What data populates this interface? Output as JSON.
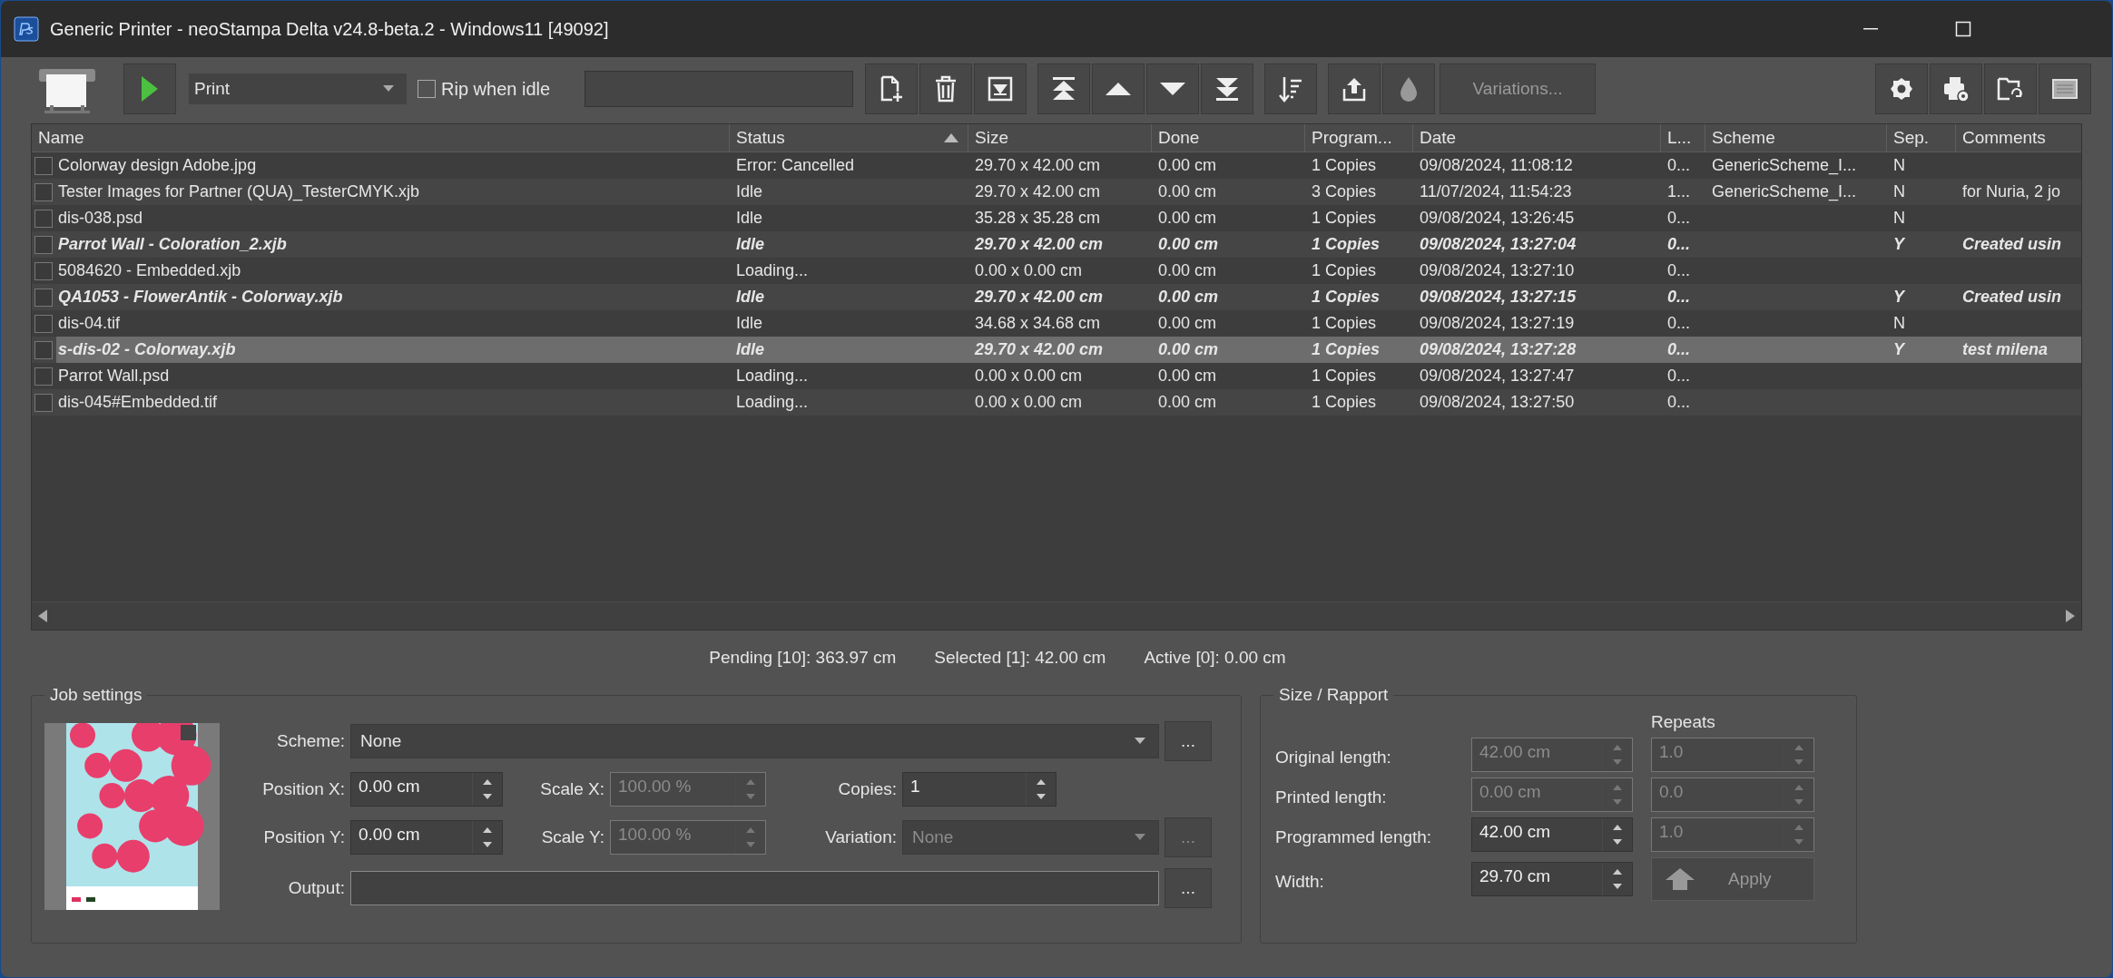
{
  "window": {
    "title": "Generic Printer - neoStampa Delta v24.8-beta.2 - Windows11 [49092]"
  },
  "toolbar": {
    "mode": "Print",
    "rip_when_idle": {
      "label": "Rip when idle",
      "checked": false
    },
    "variations_button": {
      "label": "Variations...",
      "disabled": true
    }
  },
  "table": {
    "columns": [
      {
        "label": "Name"
      },
      {
        "label": "Status",
        "sorted": true
      },
      {
        "label": "Size"
      },
      {
        "label": "Done"
      },
      {
        "label": "Program..."
      },
      {
        "label": "Date"
      },
      {
        "label": "L..."
      },
      {
        "label": "Scheme"
      },
      {
        "label": "Sep."
      },
      {
        "label": "Comments"
      }
    ],
    "rows": [
      {
        "checked": false,
        "bold": false,
        "selected": false,
        "cells": [
          "Colorway design Adobe.jpg",
          "Error: Cancelled",
          "29.70 x 42.00 cm",
          "0.00 cm",
          "1 Copies",
          "09/08/2024, 11:08:12",
          "0...",
          "GenericScheme_I...",
          "N",
          ""
        ]
      },
      {
        "checked": false,
        "bold": false,
        "selected": false,
        "cells": [
          "Tester Images for Partner (QUA)_TesterCMYK.xjb",
          "Idle",
          "29.70 x 42.00 cm",
          "0.00 cm",
          "3 Copies",
          "11/07/2024, 11:54:23",
          "1...",
          "GenericScheme_I...",
          "N",
          "for Nuria, 2 jo"
        ]
      },
      {
        "checked": false,
        "bold": false,
        "selected": false,
        "cells": [
          "dis-038.psd",
          "Idle",
          "35.28 x 35.28 cm",
          "0.00 cm",
          "1 Copies",
          "09/08/2024, 13:26:45",
          "0...",
          "",
          "N",
          ""
        ]
      },
      {
        "checked": false,
        "bold": true,
        "selected": false,
        "cells": [
          "Parrot Wall - Coloration_2.xjb",
          "Idle",
          "29.70 x 42.00 cm",
          "0.00 cm",
          "1 Copies",
          "09/08/2024, 13:27:04",
          "0...",
          "",
          "Y",
          "Created usin"
        ]
      },
      {
        "checked": false,
        "bold": false,
        "selected": false,
        "cells": [
          "5084620 - Embedded.xjb",
          "Loading...",
          "0.00 x 0.00 cm",
          "0.00 cm",
          "1 Copies",
          "09/08/2024, 13:27:10",
          "0...",
          "",
          "",
          ""
        ]
      },
      {
        "checked": false,
        "bold": true,
        "selected": false,
        "cells": [
          "QA1053 - FlowerAntik - Colorway.xjb",
          "Idle",
          "29.70 x 42.00 cm",
          "0.00 cm",
          "1 Copies",
          "09/08/2024, 13:27:15",
          "0...",
          "",
          "Y",
          "Created usin"
        ]
      },
      {
        "checked": false,
        "bold": false,
        "selected": false,
        "cells": [
          "dis-04.tif",
          "Idle",
          "34.68 x 34.68 cm",
          "0.00 cm",
          "1 Copies",
          "09/08/2024, 13:27:19",
          "0...",
          "",
          "N",
          ""
        ]
      },
      {
        "checked": false,
        "bold": true,
        "selected": true,
        "cells": [
          "s-dis-02 - Colorway.xjb",
          "Idle",
          "29.70 x 42.00 cm",
          "0.00 cm",
          "1 Copies",
          "09/08/2024, 13:27:28",
          "0...",
          "",
          "Y",
          "test milena"
        ]
      },
      {
        "checked": false,
        "bold": false,
        "selected": false,
        "cells": [
          "Parrot Wall.psd",
          "Loading...",
          "0.00 x 0.00 cm",
          "0.00 cm",
          "1 Copies",
          "09/08/2024, 13:27:47",
          "0...",
          "",
          "",
          ""
        ]
      },
      {
        "checked": false,
        "bold": false,
        "selected": false,
        "cells": [
          "dis-045#Embedded.tif",
          "Loading...",
          "0.00 x 0.00 cm",
          "0.00 cm",
          "1 Copies",
          "09/08/2024, 13:27:50",
          "0...",
          "",
          "",
          ""
        ]
      }
    ]
  },
  "summary": [
    "Pending [10]: 363.97 cm",
    "Selected [1]: 42.00 cm",
    "Active [0]: 0.00 cm"
  ],
  "job_settings": {
    "title": "Job settings",
    "scheme": {
      "label": "Scheme:",
      "value": "None",
      "disabled": false,
      "browse": "..."
    },
    "position_x": {
      "label": "Position X:",
      "value": "0.00 cm",
      "disabled": false
    },
    "scale_x": {
      "label": "Scale X:",
      "value": "100.00 %",
      "disabled": true
    },
    "copies": {
      "label": "Copies:",
      "value": "1",
      "disabled": false
    },
    "position_y": {
      "label": "Position Y:",
      "value": "0.00 cm",
      "disabled": false
    },
    "scale_y": {
      "label": "Scale Y:",
      "value": "100.00 %",
      "disabled": true
    },
    "variation": {
      "label": "Variation:",
      "value": "None",
      "disabled": true,
      "browse": "..."
    },
    "output": {
      "label": "Output:",
      "disabled": false,
      "browse": "..."
    }
  },
  "size_rapport": {
    "title": "Size / Rapport",
    "repeats_label": "Repeats",
    "rows": [
      {
        "label": "Original length:",
        "length": {
          "value": "42.00 cm",
          "disabled": true
        },
        "repeats": {
          "value": "1.0",
          "disabled": true
        }
      },
      {
        "label": "Printed length:",
        "length": {
          "value": "0.00 cm",
          "disabled": true
        },
        "repeats": {
          "value": "0.0",
          "disabled": true
        }
      },
      {
        "label": "Programmed length:",
        "length": {
          "value": "42.00 cm",
          "disabled": false
        },
        "repeats": {
          "value": "1.0",
          "disabled": true
        }
      },
      {
        "label": "Width:",
        "length": {
          "value": "29.70 cm",
          "disabled": false
        }
      }
    ],
    "apply_button": {
      "label": "Apply",
      "disabled": true
    }
  }
}
